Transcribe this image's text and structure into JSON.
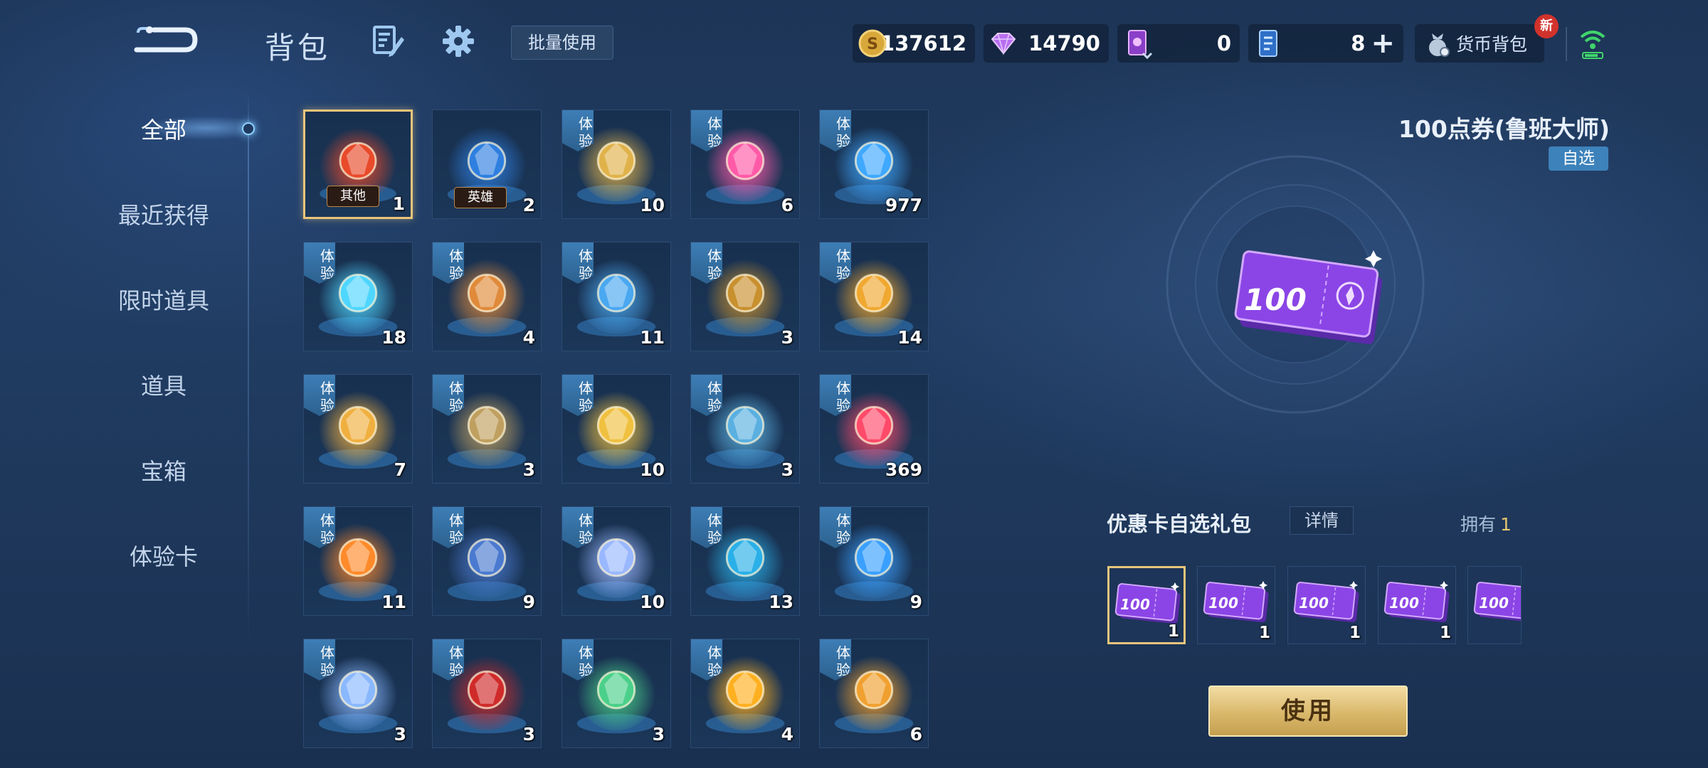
{
  "header": {
    "title": "背包",
    "batch_use_label": "批量使用",
    "currencies": {
      "gold": "137612",
      "diamond": "14790",
      "card": "0",
      "coupon": "8"
    },
    "currency_bag_label": "货币背包",
    "new_badge": "新"
  },
  "sidebar": {
    "items": [
      {
        "label": "全部"
      },
      {
        "label": "最近获得"
      },
      {
        "label": "限时道具"
      },
      {
        "label": "道具"
      },
      {
        "label": "宝箱"
      },
      {
        "label": "体验卡"
      }
    ]
  },
  "grid": {
    "trial_tag": "体验",
    "items": [
      {
        "count": "1",
        "label": "其他",
        "trial": false,
        "icon": "gift-orb-icon",
        "color": "#e84a2a"
      },
      {
        "count": "2",
        "label": "英雄",
        "trial": false,
        "icon": "hero-orb-icon",
        "color": "#2e7fe0"
      },
      {
        "count": "10",
        "trial": true,
        "icon": "golden-crest-icon",
        "color": "#e0b24a"
      },
      {
        "count": "6",
        "trial": true,
        "icon": "heart-icon",
        "color": "#ff5aa8"
      },
      {
        "count": "977",
        "trial": true,
        "icon": "blue-crest-icon",
        "color": "#3fa8ff"
      },
      {
        "count": "18",
        "trial": true,
        "icon": "cool-emote-icon",
        "color": "#4fd6ff"
      },
      {
        "count": "4",
        "trial": true,
        "icon": "pavilion-icon",
        "color": "#e08a3a"
      },
      {
        "count": "11",
        "trial": true,
        "icon": "blue-gold-crest-icon",
        "color": "#4aa8f0"
      },
      {
        "count": "3",
        "trial": true,
        "icon": "banner-icon",
        "color": "#c8902e"
      },
      {
        "count": "14",
        "trial": true,
        "icon": "phoenix-icon",
        "color": "#f0a830"
      },
      {
        "count": "7",
        "trial": true,
        "icon": "treasure-icon",
        "color": "#f0b040"
      },
      {
        "count": "3",
        "trial": true,
        "icon": "winged-badge-icon",
        "color": "#c0a060"
      },
      {
        "count": "10",
        "trial": true,
        "icon": "celebration-icon",
        "color": "#f0c040"
      },
      {
        "count": "3",
        "trial": true,
        "icon": "windmill-icon",
        "color": "#5ab0e0"
      },
      {
        "count": "369",
        "trial": true,
        "icon": "heart-balloon-icon",
        "color": "#ff4a6a"
      },
      {
        "count": "11",
        "trial": true,
        "icon": "fire-scroll-icon",
        "color": "#ff8a2a"
      },
      {
        "count": "9",
        "trial": true,
        "icon": "text-banner-icon",
        "color": "#4a7ad0"
      },
      {
        "count": "10",
        "trial": true,
        "icon": "moon-stage-icon",
        "color": "#9ab8ff"
      },
      {
        "count": "13",
        "trial": true,
        "icon": "wave-icon",
        "color": "#2ab0e8"
      },
      {
        "count": "9",
        "trial": true,
        "icon": "portal-card-icon",
        "color": "#3aa0ff"
      },
      {
        "count": "3",
        "trial": true,
        "icon": "soccer-ball-icon",
        "color": "#8ab8ff"
      },
      {
        "count": "3",
        "trial": true,
        "icon": "eye-banner-icon",
        "color": "#d02a2a"
      },
      {
        "count": "3",
        "trial": true,
        "icon": "garden-icon",
        "color": "#4ad08a"
      },
      {
        "count": "4",
        "trial": true,
        "icon": "golden-cube-icon",
        "color": "#ffb020"
      },
      {
        "count": "6",
        "trial": true,
        "icon": "tiger-icon",
        "color": "#f0a030"
      }
    ]
  },
  "detail": {
    "title": "100点券(鲁班大师)",
    "badge": "自选",
    "ticket_value": "100",
    "pack_title": "优惠卡自选礼包",
    "detail_label": "详情",
    "own_label": "拥有",
    "own_count": "1",
    "options": [
      {
        "count": "1",
        "value": "100"
      },
      {
        "count": "1",
        "value": "100"
      },
      {
        "count": "1",
        "value": "100"
      },
      {
        "count": "1",
        "value": "100"
      },
      {
        "count": "",
        "value": "100"
      }
    ],
    "use_label": "使用"
  }
}
